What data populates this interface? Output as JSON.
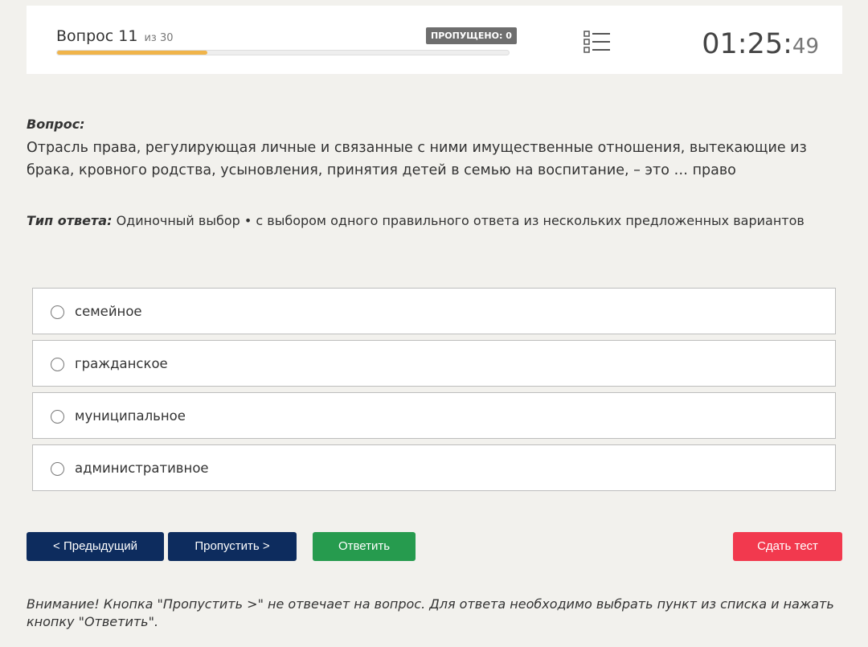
{
  "header": {
    "question_word": "Вопрос 11",
    "question_of": "из 30",
    "skipped_label": "ПРОПУЩЕНО: 0",
    "progress_fraction": 0.3333,
    "timer_main": "01:25:",
    "timer_seconds": "49",
    "list_icon": "list-icon"
  },
  "question": {
    "label": "Вопрос:",
    "text": "Отрасль права, регулирующая личные и связанные с ними имущественные отношения, вытекающие из брака, кровного родства, усыновления, принятия детей в семью на воспитание, – это … право"
  },
  "answer_type": {
    "label": "Тип ответа:",
    "value": "Одиночный выбор • с выбором одного правильного ответа из нескольких предложенных вариантов"
  },
  "options": [
    {
      "label": "семейное"
    },
    {
      "label": "гражданское"
    },
    {
      "label": "муниципальное"
    },
    {
      "label": "административное"
    }
  ],
  "buttons": {
    "prev": "< Предыдущий",
    "skip": "Пропустить >",
    "answer": "Ответить",
    "submit": "Сдать тест"
  },
  "colors": {
    "progress": "#f0b44a",
    "nav_button": "#0d2c5e",
    "answer_button": "#269b4e",
    "submit_button": "#f2394e"
  },
  "warning": "Внимание! Кнопка \"Пропустить >\" не отвечает на вопрос. Для ответа необходимо выбрать пункт из списка и нажать кнопку \"Ответить\"."
}
